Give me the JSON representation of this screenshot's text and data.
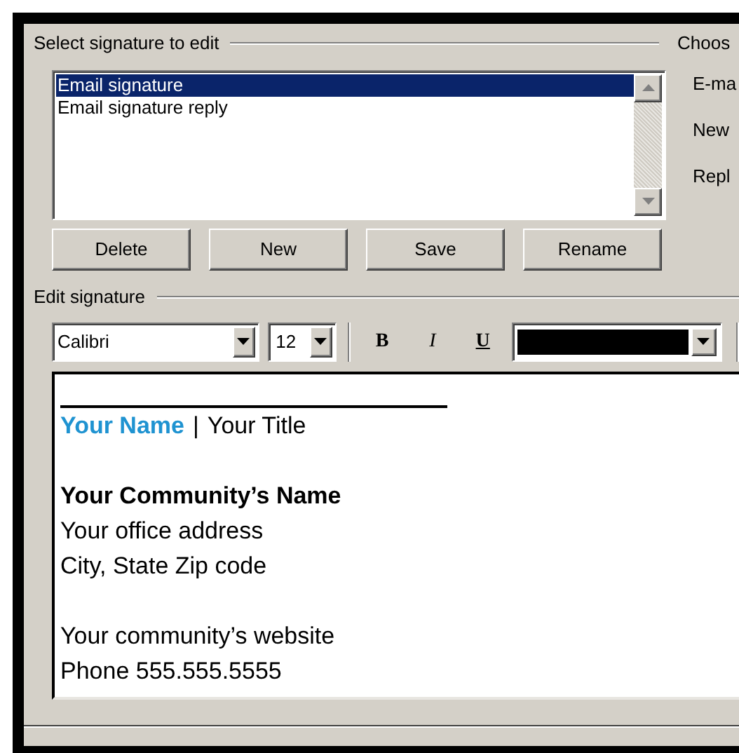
{
  "select_group": {
    "label": "Select signature to edit",
    "signatures": [
      {
        "label": "Email signature",
        "selected": true
      },
      {
        "label": "Email signature reply",
        "selected": false
      }
    ],
    "buttons": [
      "Delete",
      "New",
      "Save",
      "Rename"
    ]
  },
  "choose_group": {
    "label": "Choos",
    "fields": [
      "E-ma",
      "New",
      "Repl"
    ]
  },
  "edit_group": {
    "label": "Edit signature",
    "toolbar": {
      "font": "Calibri",
      "size": "12",
      "bold": "B",
      "italic": "I",
      "underline": "U",
      "color": "#000000"
    },
    "lines": [
      {
        "kind": "rule"
      },
      {
        "kind": "name_title",
        "name": "Your Name",
        "separator": "|",
        "title": "Your Title",
        "color": "#1f93d1"
      },
      {
        "kind": "blank"
      },
      {
        "kind": "heading",
        "text": "Your Community’s Name"
      },
      {
        "kind": "text",
        "text": "Your office address"
      },
      {
        "kind": "text",
        "text": "City, State Zip code"
      },
      {
        "kind": "blank"
      },
      {
        "kind": "text",
        "text": "Your community’s website"
      },
      {
        "kind": "text",
        "text": "Phone 555.555.5555"
      }
    ]
  }
}
